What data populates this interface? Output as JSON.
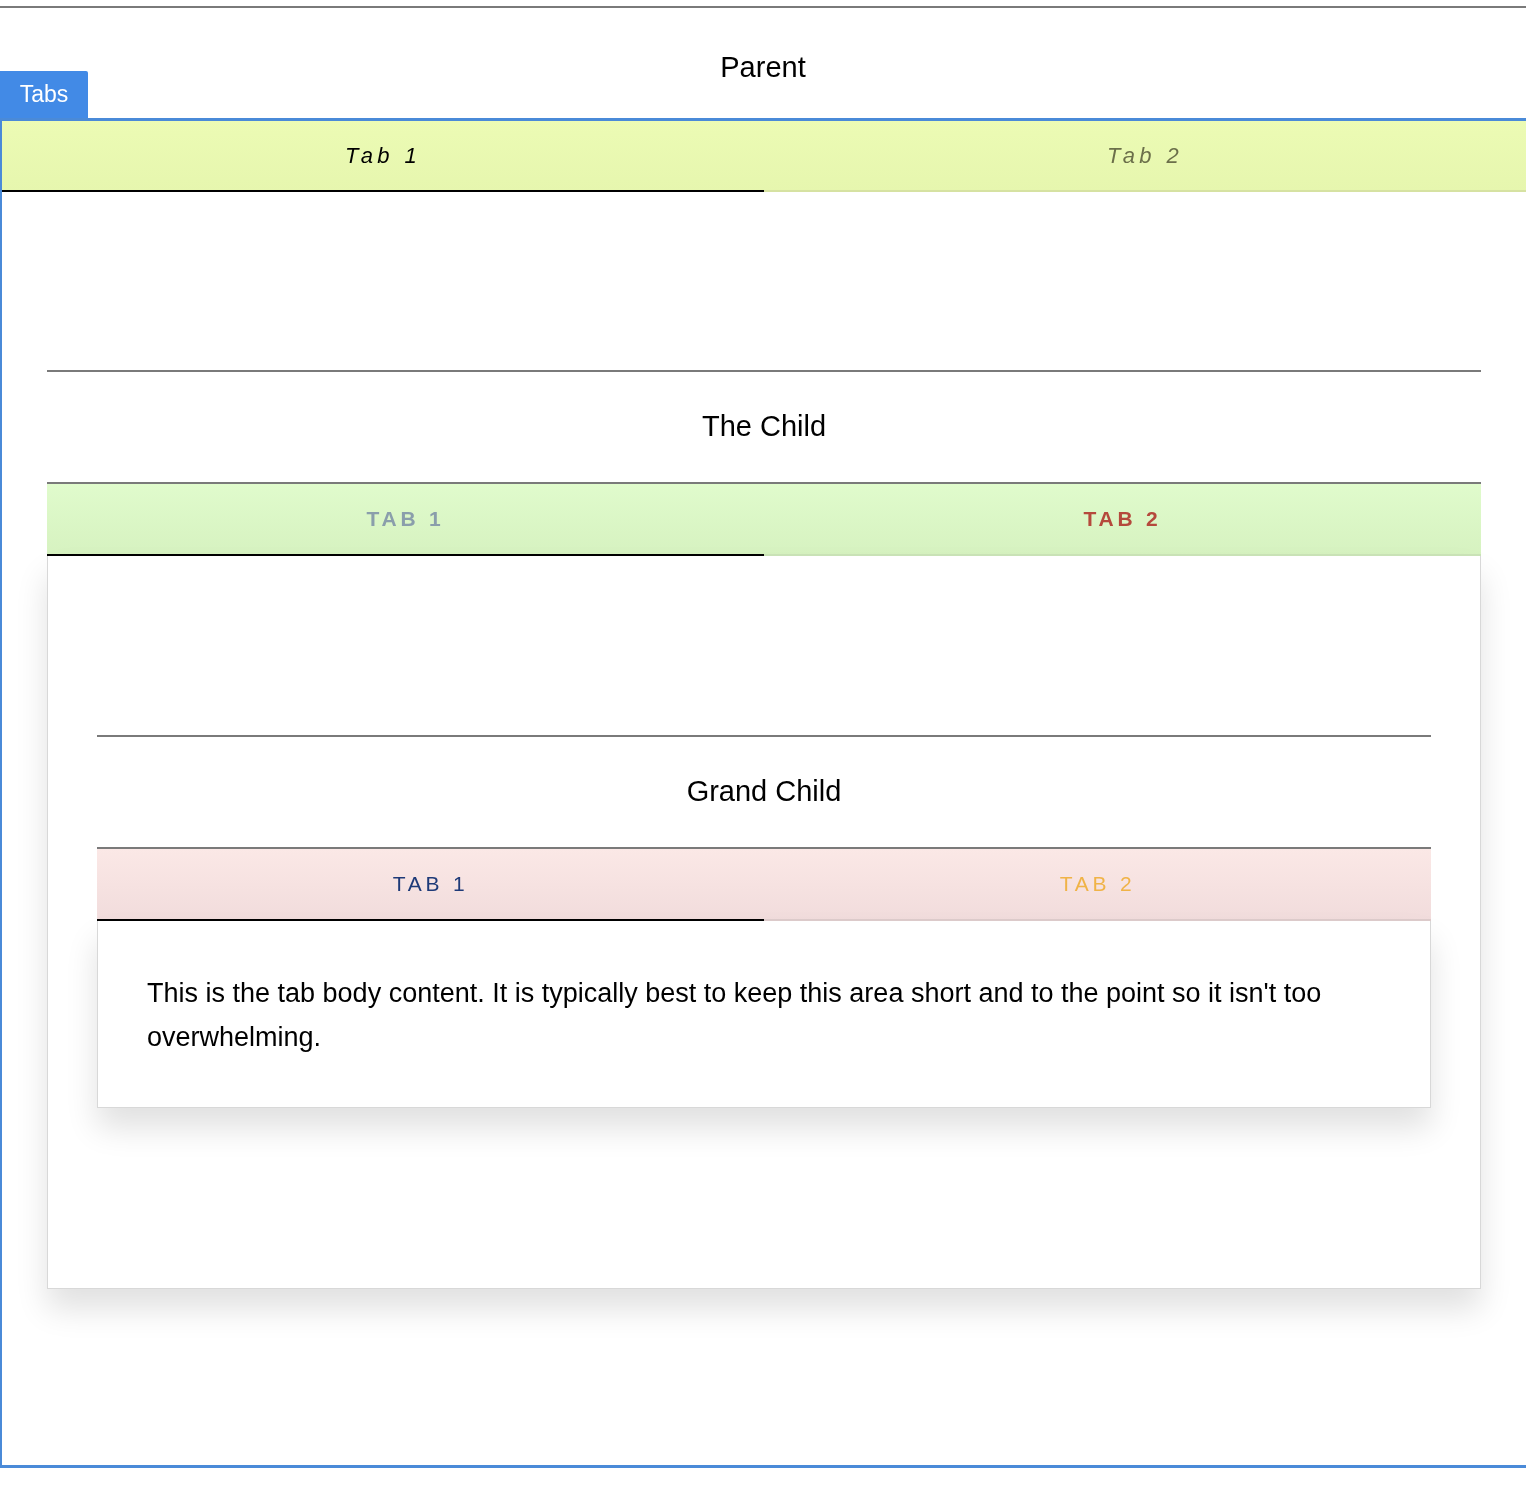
{
  "badge": "Tabs",
  "parent": {
    "title": "Parent",
    "kind": "italic",
    "tabs": [
      {
        "label": "Tab 1",
        "selected": true,
        "color": "#000000"
      },
      {
        "label": "Tab 2",
        "selected": false,
        "color": "#6b6f4a"
      }
    ]
  },
  "child": {
    "title": "The Child",
    "kind": "bold-caps",
    "tabs": [
      {
        "label": "TAB 1",
        "selected": true,
        "color": "#8a9eab"
      },
      {
        "label": "TAB 2",
        "selected": false,
        "color": "#b5493c"
      }
    ]
  },
  "grandchild": {
    "title": "Grand Child",
    "kind": "caps",
    "tabs": [
      {
        "label": "TAB 1",
        "selected": true,
        "color": "#1e3a78"
      },
      {
        "label": "TAB 2",
        "selected": false,
        "color": "#f0b347"
      }
    ],
    "body": "This is the tab body content. It is typically best to keep this area short and to the point so it isn't too overwhelming."
  }
}
